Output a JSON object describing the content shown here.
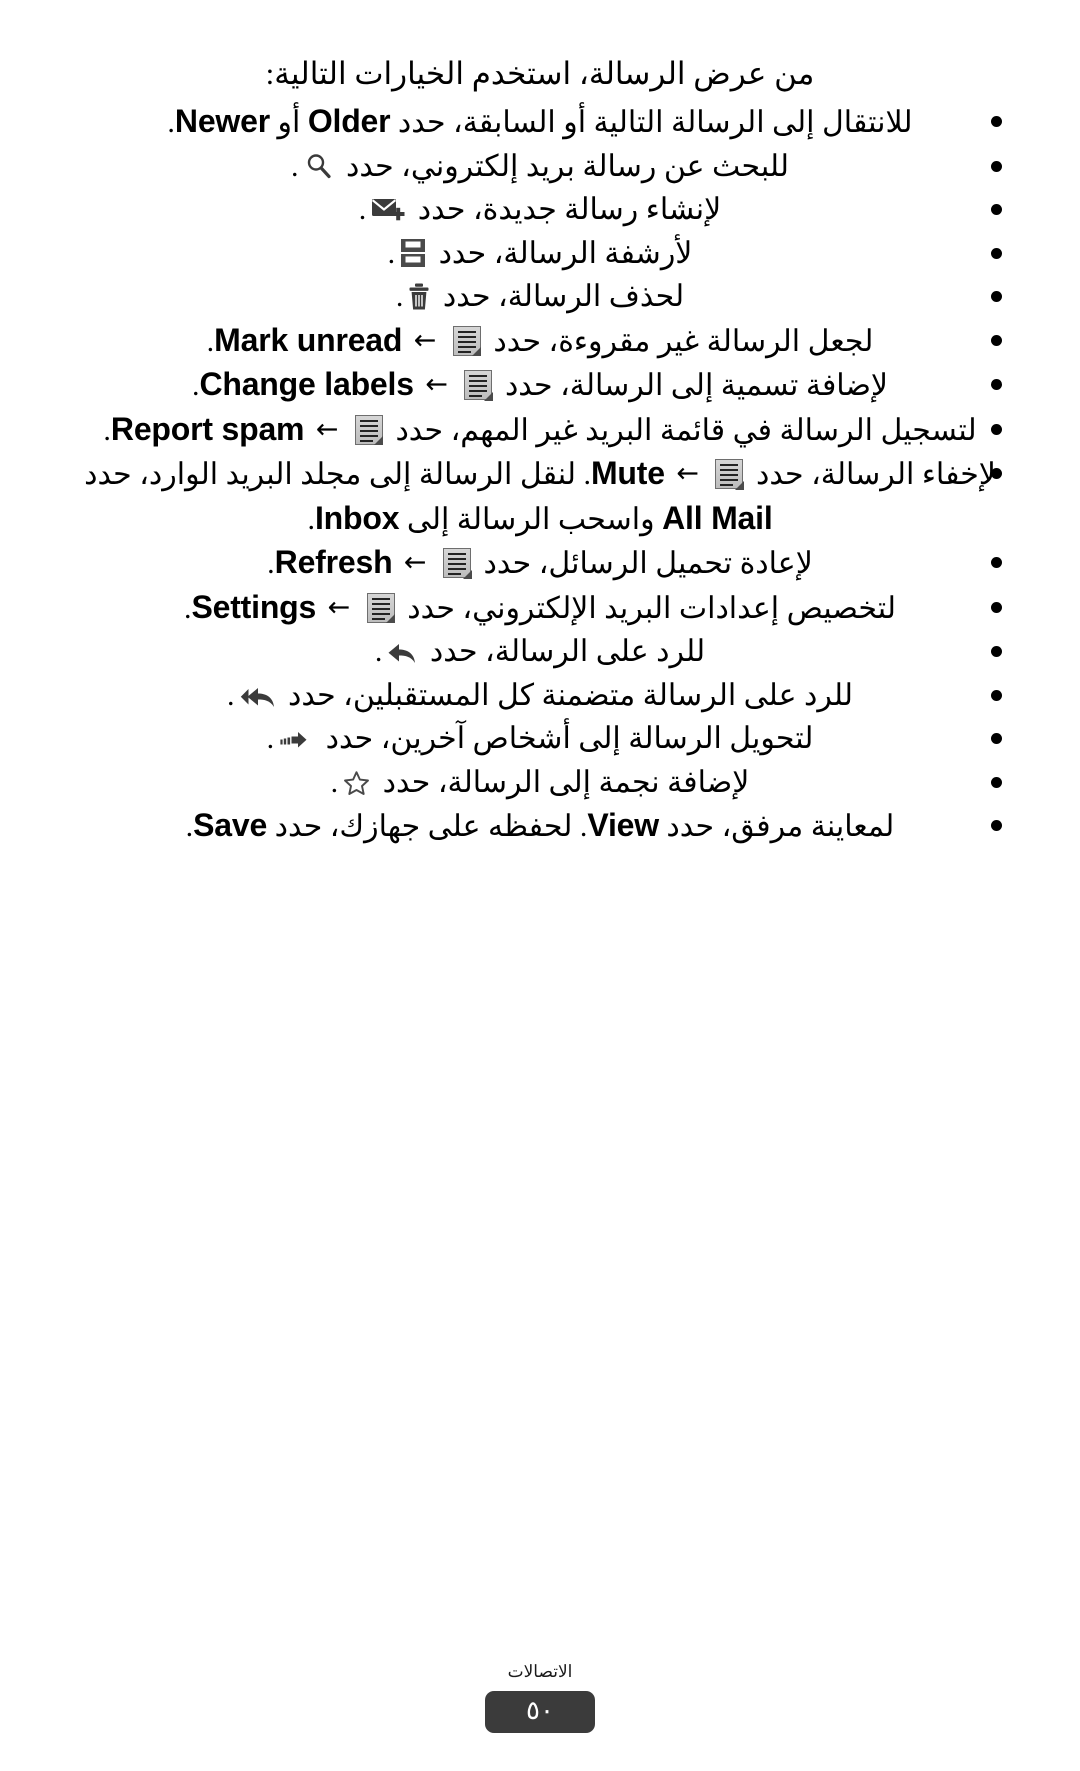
{
  "document": {
    "language": "ar",
    "direction": "rtl",
    "intro": "من عرض الرسالة، استخدم الخيارات التالية:"
  },
  "options": [
    {
      "id": "navigate-messages",
      "pre": "للانتقال إلى الرسالة التالية أو السابقة، حدد",
      "icon": null,
      "arrow": null,
      "term": "Older",
      "mid": "أو",
      "term2": "Newer",
      "post": "."
    },
    {
      "id": "search-email",
      "pre": "للبحث عن رسالة بريد إلكتروني، حدد",
      "icon": "search-icon",
      "post": "."
    },
    {
      "id": "compose-message",
      "pre": "لإنشاء رسالة جديدة، حدد",
      "icon": "compose-icon",
      "post": "."
    },
    {
      "id": "archive-message",
      "pre": "لأرشفة الرسالة، حدد",
      "icon": "archive-icon",
      "post": "."
    },
    {
      "id": "delete-message",
      "pre": "لحذف الرسالة، حدد",
      "icon": "trash-icon",
      "post": "."
    },
    {
      "id": "mark-unread",
      "pre": "لجعل الرسالة غير مقروءة، حدد",
      "icon": "menu-icon",
      "arrow": "←",
      "term": "Mark unread",
      "post": "."
    },
    {
      "id": "change-labels",
      "pre": "لإضافة تسمية إلى الرسالة، حدد",
      "icon": "menu-icon",
      "arrow": "←",
      "term": "Change labels",
      "post": "."
    },
    {
      "id": "report-spam",
      "pre": "لتسجيل الرسالة في قائمة البريد غير المهم، حدد",
      "icon": "menu-icon",
      "arrow": "←",
      "term": "Report spam",
      "post": "."
    },
    {
      "id": "mute-message",
      "pre": "لإخفاء الرسالة، حدد",
      "icon": "menu-icon",
      "arrow": "←",
      "term": "Mute",
      "post": ". لنقل الرسالة إلى مجلد البريد الوارد، حدد",
      "term2": "All Mail",
      "mid2": "واسحب الرسالة إلى",
      "term3": "Inbox",
      "post2": "."
    },
    {
      "id": "refresh-messages",
      "pre": "لإعادة تحميل الرسائل، حدد",
      "icon": "menu-icon",
      "arrow": "←",
      "term": "Refresh",
      "post": "."
    },
    {
      "id": "email-settings",
      "pre": "لتخصيص إعدادات البريد الإلكتروني، حدد",
      "icon": "menu-icon",
      "arrow": "←",
      "term": "Settings",
      "post": "."
    },
    {
      "id": "reply-message",
      "pre": "للرد على الرسالة، حدد",
      "icon": "reply-icon",
      "post": "."
    },
    {
      "id": "reply-all",
      "pre": "للرد على الرسالة متضمنة كل المستقبلين، حدد",
      "icon": "reply-all-icon",
      "post": "."
    },
    {
      "id": "forward-message",
      "pre": "لتحويل الرسالة إلى أشخاص آخرين، حدد",
      "icon": "forward-icon",
      "post": "."
    },
    {
      "id": "star-message",
      "pre": "لإضافة نجمة إلى الرسالة، حدد",
      "icon": "star-icon",
      "post": "."
    },
    {
      "id": "view-save-attachment",
      "pre": "لمعاينة مرفق، حدد",
      "term": "View",
      "mid": ". لحفظه على جهازك، حدد",
      "term2": "Save",
      "post": "."
    }
  ],
  "footer": {
    "section_label": "الاتصالات",
    "page_number": "٥٠"
  },
  "colors": {
    "text": "#000000",
    "icon_menu_fill": "#c8c8c8",
    "icon_menu_border": "#6e6e6e",
    "icon_dark": "#3b3b3b",
    "page_badge_bg": "#3b3b3b",
    "page_badge_text": "#ffffff"
  }
}
